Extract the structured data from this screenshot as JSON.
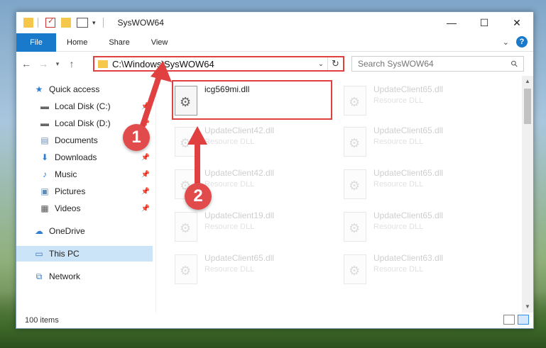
{
  "window": {
    "title": "SysWOW64",
    "controls": {
      "minimize": "—",
      "maximize": "☐",
      "close": "✕"
    }
  },
  "ribbon": {
    "tabs": [
      "File",
      "Home",
      "Share",
      "View"
    ],
    "help": "?"
  },
  "address_bar": {
    "path": "C:\\Windows\\SysWOW64"
  },
  "search": {
    "placeholder": "Search SysWOW64"
  },
  "sidebar": {
    "items": [
      {
        "label": "Quick access",
        "icon": "star-icon",
        "pinned": false
      },
      {
        "label": "Local Disk (C:)",
        "icon": "drive-icon",
        "pinned": true
      },
      {
        "label": "Local Disk (D:)",
        "icon": "drive-icon",
        "pinned": true
      },
      {
        "label": "Documents",
        "icon": "documents-icon",
        "pinned": true
      },
      {
        "label": "Downloads",
        "icon": "downloads-icon",
        "pinned": true
      },
      {
        "label": "Music",
        "icon": "music-icon",
        "pinned": true
      },
      {
        "label": "Pictures",
        "icon": "pictures-icon",
        "pinned": true
      },
      {
        "label": "Videos",
        "icon": "videos-icon",
        "pinned": true
      },
      {
        "label": "OneDrive",
        "icon": "cloud-icon",
        "pinned": false
      },
      {
        "label": "This PC",
        "icon": "computer-icon",
        "pinned": false,
        "selected": true
      },
      {
        "label": "Network",
        "icon": "network-icon",
        "pinned": false
      }
    ]
  },
  "files": [
    {
      "name": "icg569mi.dll",
      "type": "",
      "highlighted": true
    },
    {
      "name": "UpdateClient65.dll",
      "type": "Resource DLL"
    },
    {
      "name": "UpdateClient42.dll",
      "type": "Resource DLL"
    },
    {
      "name": "UpdateClient65.dll",
      "type": "Resource DLL"
    },
    {
      "name": "UpdateClient42.dll",
      "type": "Resource DLL"
    },
    {
      "name": "UpdateClient65.dll",
      "type": "Resource DLL"
    },
    {
      "name": "UpdateClient19.dll",
      "type": "Resource DLL"
    },
    {
      "name": "UpdateClient65.dll",
      "type": "Resource DLL"
    },
    {
      "name": "UpdateClient65.dll",
      "type": "Resource DLL"
    },
    {
      "name": "UpdateClient63.dll",
      "type": "Resource DLL"
    }
  ],
  "status": {
    "item_count": "100 items"
  },
  "annotations": {
    "step1": "1",
    "step2": "2",
    "color": "#e04040"
  }
}
